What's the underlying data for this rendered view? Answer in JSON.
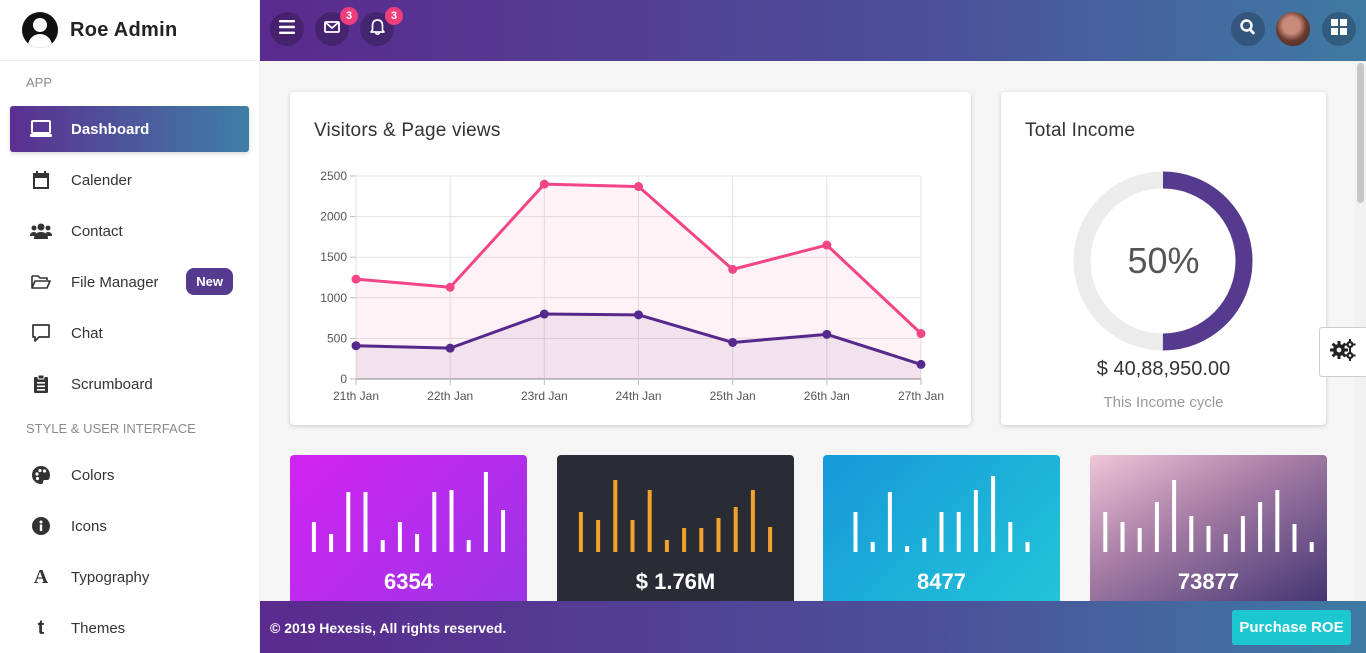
{
  "brand": {
    "title": "Roe Admin"
  },
  "sidebar": {
    "sections": [
      {
        "label": "APP"
      },
      {
        "label": "STYLE & USER INTERFACE"
      }
    ],
    "items": [
      {
        "label": "Dashboard",
        "icon": "laptop-icon",
        "active": true
      },
      {
        "label": "Calender",
        "icon": "calendar-icon"
      },
      {
        "label": "Contact",
        "icon": "users-icon"
      },
      {
        "label": "File Manager",
        "icon": "folder-open-icon",
        "badge": "New"
      },
      {
        "label": "Chat",
        "icon": "chat-icon"
      },
      {
        "label": "Scrumboard",
        "icon": "clipboard-icon"
      },
      {
        "label": "Colors",
        "icon": "palette-icon"
      },
      {
        "label": "Icons",
        "icon": "info-icon"
      },
      {
        "label": "Typography",
        "icon": "font-icon"
      },
      {
        "label": "Themes",
        "icon": "tumblr-icon"
      }
    ]
  },
  "topbar": {
    "mail_count": "3",
    "notification_count": "3"
  },
  "visitors_card": {
    "title": "Visitors & Page views"
  },
  "chart_data": {
    "type": "line",
    "categories": [
      "21th Jan",
      "22th Jan",
      "23rd Jan",
      "24th Jan",
      "25th Jan",
      "26th Jan",
      "27th Jan"
    ],
    "y_ticks": [
      "0",
      "500",
      "1000",
      "1500",
      "2000",
      "2500"
    ],
    "ylim": [
      0,
      2500
    ],
    "grid": true,
    "series": [
      {
        "values": [
          1230,
          1130,
          2400,
          2370,
          1350,
          1650,
          560
        ],
        "color": "#f24585",
        "fill": "rgba(242,69,133,0.07)"
      },
      {
        "values": [
          410,
          380,
          800,
          790,
          450,
          550,
          180
        ],
        "color": "#55288c",
        "fill": "rgba(85,40,140,0.08)"
      }
    ]
  },
  "income_card": {
    "title": "Total Income",
    "percent": "50%",
    "percent_value": 0.5,
    "amount": "$ 40,88,950.00",
    "caption": "This Income cycle"
  },
  "stats": [
    {
      "value": "6354",
      "bars": [
        30,
        18,
        60,
        60,
        12,
        30,
        18,
        60,
        62,
        12,
        80,
        42
      ]
    },
    {
      "value": "$ 1.76M",
      "bars": [
        40,
        32,
        72,
        32,
        62,
        12,
        24,
        24,
        34,
        45,
        62,
        25
      ]
    },
    {
      "value": "8477",
      "bars": [
        40,
        10,
        60,
        6,
        14,
        40,
        40,
        62,
        76,
        30,
        10
      ]
    },
    {
      "value": "73877",
      "bars": [
        40,
        30,
        24,
        50,
        72,
        36,
        26,
        18,
        36,
        50,
        62,
        28,
        10
      ]
    }
  ],
  "footer": {
    "copyright": "© 2019 Hexesis, All rights reserved.",
    "purchase_label": "Purchase ROE"
  },
  "colors": {
    "brand_gradient_start": "#5b2a8e",
    "brand_gradient_end": "#3f7aa3",
    "accent_pink": "#f03d7c",
    "accent_cyan": "#1cc7d0"
  }
}
